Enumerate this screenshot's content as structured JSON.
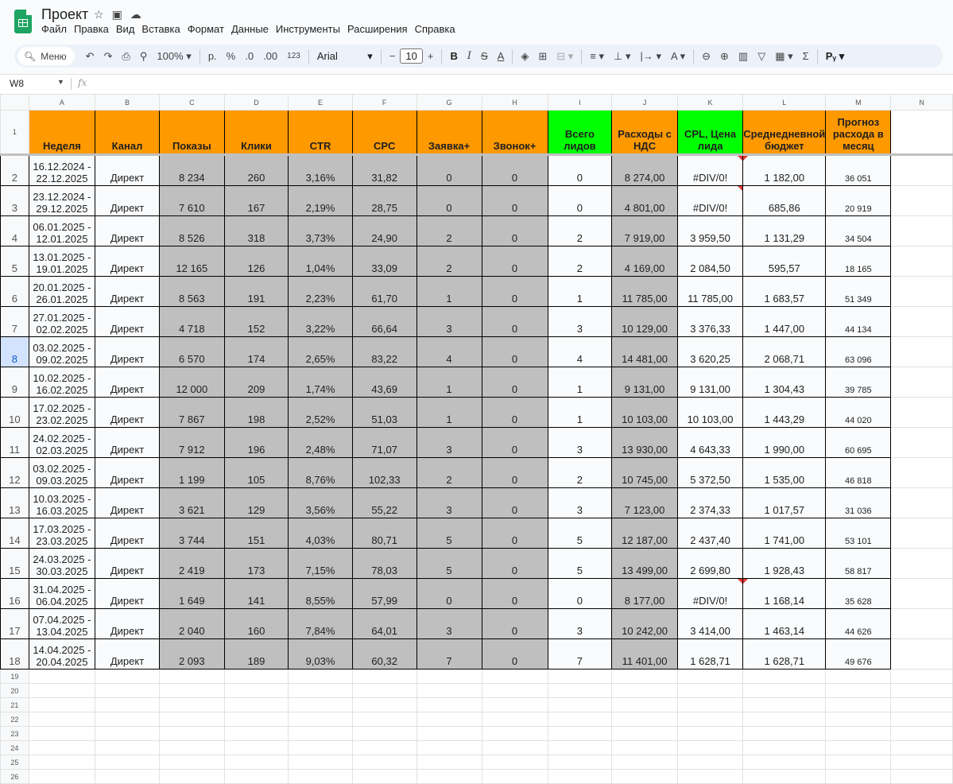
{
  "app": {
    "title": "Проект",
    "menu": [
      "Файл",
      "Правка",
      "Вид",
      "Вставка",
      "Формат",
      "Данные",
      "Инструменты",
      "Расширения",
      "Справка"
    ]
  },
  "toolbar": {
    "search_label": "Меню",
    "zoom": "100%",
    "currency": "р.",
    "percent": "%",
    "dec_less": ".0",
    "dec_more": ".00",
    "num_format": "123",
    "font": "Arial",
    "font_size": "10",
    "bold": "B",
    "italic": "I",
    "text_color": "A",
    "rv": "Pᵧ"
  },
  "formula_bar": {
    "cell_ref": "W8",
    "fx": "fx"
  },
  "sheet": {
    "columns": [
      "A",
      "B",
      "C",
      "D",
      "E",
      "F",
      "G",
      "H",
      "I",
      "J",
      "K",
      "L",
      "M",
      "N"
    ],
    "headers": [
      "Неделя",
      "Канал",
      "Показы",
      "Клики",
      "CTR",
      "CPC",
      "Заявка+",
      "Звонок+",
      "Всего лидов",
      "Расходы с НДС",
      "CPL, Цена лида",
      "Среднедневной бюджет",
      "Прогноз расхода в месяц"
    ],
    "header_colors": {
      "orange": "#ff9900",
      "green": "#00ff00",
      "gray": "#bfbfbf"
    },
    "rows": [
      [
        "16.12.2024 - 22.12.2025",
        "Директ",
        "8 234",
        "260",
        "3,16%",
        "31,82",
        "0",
        "0",
        "0",
        "8 274,00",
        "#DIV/0!",
        "1 182,00",
        "36 051"
      ],
      [
        "23.12.2024 - 29.12.2025",
        "Директ",
        "7 610",
        "167",
        "2,19%",
        "28,75",
        "0",
        "0",
        "0",
        "4 801,00",
        "#DIV/0!",
        "685,86",
        "20 919"
      ],
      [
        "06.01.2025 - 12.01.2025",
        "Директ",
        "8 526",
        "318",
        "3,73%",
        "24,90",
        "2",
        "0",
        "2",
        "7 919,00",
        "3 959,50",
        "1 131,29",
        "34 504"
      ],
      [
        "13.01.2025 - 19.01.2025",
        "Директ",
        "12 165",
        "126",
        "1,04%",
        "33,09",
        "2",
        "0",
        "2",
        "4 169,00",
        "2 084,50",
        "595,57",
        "18 165"
      ],
      [
        "20.01.2025 - 26.01.2025",
        "Директ",
        "8 563",
        "191",
        "2,23%",
        "61,70",
        "1",
        "0",
        "1",
        "11 785,00",
        "11 785,00",
        "1 683,57",
        "51 349"
      ],
      [
        "27.01.2025 - 02.02.2025",
        "Директ",
        "4 718",
        "152",
        "3,22%",
        "66,64",
        "3",
        "0",
        "3",
        "10 129,00",
        "3 376,33",
        "1 447,00",
        "44 134"
      ],
      [
        "03.02.2025 - 09.02.2025",
        "Директ",
        "6 570",
        "174",
        "2,65%",
        "83,22",
        "4",
        "0",
        "4",
        "14 481,00",
        "3 620,25",
        "2 068,71",
        "63 096"
      ],
      [
        "10.02.2025 - 16.02.2025",
        "Директ",
        "12 000",
        "209",
        "1,74%",
        "43,69",
        "1",
        "0",
        "1",
        "9 131,00",
        "9 131,00",
        "1 304,43",
        "39 785"
      ],
      [
        "17.02.2025 - 23.02.2025",
        "Директ",
        "7 867",
        "198",
        "2,52%",
        "51,03",
        "1",
        "0",
        "1",
        "10 103,00",
        "10 103,00",
        "1 443,29",
        "44 020"
      ],
      [
        "24.02.2025 - 02.03.2025",
        "Директ",
        "7 912",
        "196",
        "2,48%",
        "71,07",
        "3",
        "0",
        "3",
        "13 930,00",
        "4 643,33",
        "1 990,00",
        "60 695"
      ],
      [
        "03.02.2025 - 09.03.2025",
        "Директ",
        "1 199",
        "105",
        "8,76%",
        "102,33",
        "2",
        "0",
        "2",
        "10 745,00",
        "5 372,50",
        "1 535,00",
        "46 818"
      ],
      [
        "10.03.2025 - 16.03.2025",
        "Директ",
        "3 621",
        "129",
        "3,56%",
        "55,22",
        "3",
        "0",
        "3",
        "7 123,00",
        "2 374,33",
        "1 017,57",
        "31 036"
      ],
      [
        "17.03.2025 - 23.03.2025",
        "Директ",
        "3 744",
        "151",
        "4,03%",
        "80,71",
        "5",
        "0",
        "5",
        "12 187,00",
        "2 437,40",
        "1 741,00",
        "53 101"
      ],
      [
        "24.03.2025 - 30.03.2025",
        "Директ",
        "2 419",
        "173",
        "7,15%",
        "78,03",
        "5",
        "0",
        "5",
        "13 499,00",
        "2 699,80",
        "1 928,43",
        "58 817"
      ],
      [
        "31.04.2025 - 06.04.2025",
        "Директ",
        "1 649",
        "141",
        "8,55%",
        "57,99",
        "0",
        "0",
        "0",
        "8 177,00",
        "#DIV/0!",
        "1 168,14",
        "35 628"
      ],
      [
        "07.04.2025 - 13.04.2025",
        "Директ",
        "2 040",
        "160",
        "7,84%",
        "64,01",
        "3",
        "0",
        "3",
        "10 242,00",
        "3 414,00",
        "1 463,14",
        "44 626"
      ],
      [
        "14.04.2025 - 20.04.2025",
        "Директ",
        "2 093",
        "189",
        "9,03%",
        "60,32",
        "7",
        "0",
        "7",
        "11 401,00",
        "1 628,71",
        "1 628,71",
        "49 676"
      ]
    ],
    "empty_rows": [
      "19",
      "20",
      "21",
      "22",
      "23",
      "24",
      "25",
      "26"
    ],
    "selected_row": "8"
  }
}
